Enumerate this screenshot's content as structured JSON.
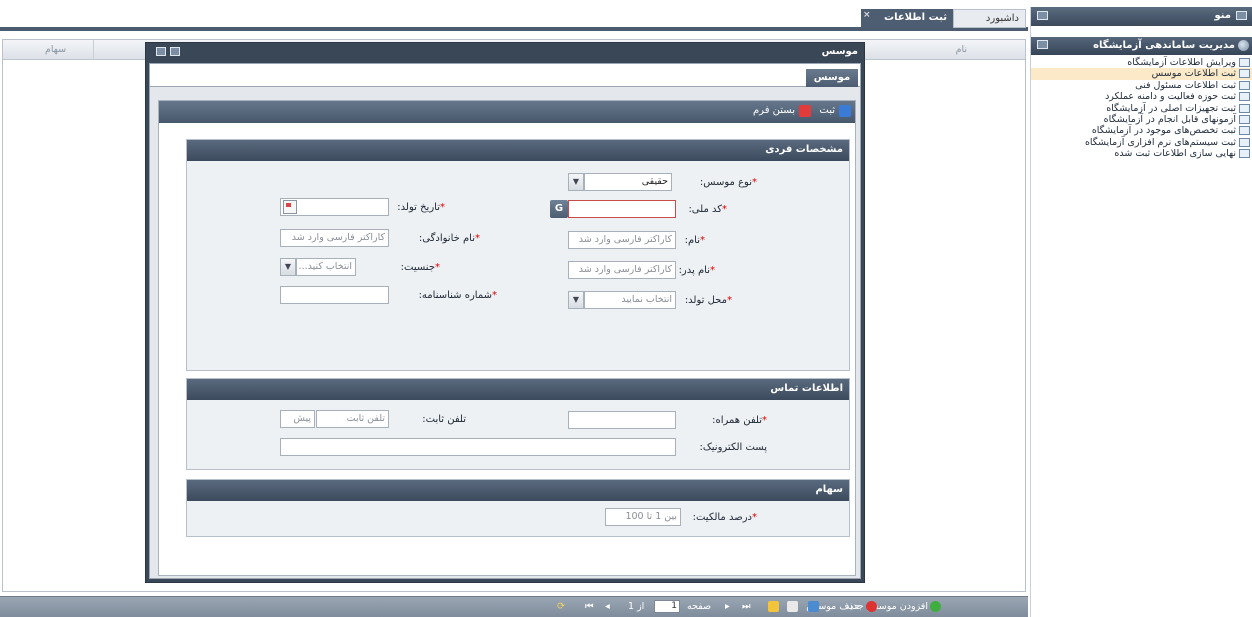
{
  "side_menu": {
    "title": "منو",
    "section_title": "مدیریت ساماندهی آزمایشگاه",
    "items": [
      {
        "label": "ویرایش اطلاعات آزمایشگاه"
      },
      {
        "label": "ثبت اطلاعات موسس"
      },
      {
        "label": "ثبت اطلاعات مسئول فنی"
      },
      {
        "label": "ثبت حوزه فعالیت و دامنه عملکرد"
      },
      {
        "label": "ثبت تجهیزات اصلی در آزمایشگاه"
      },
      {
        "label": "آزمونهای قابل انجام در آزمایشگاه"
      },
      {
        "label": "ثبت تخصص‌های موجود در آزمایشگاه"
      },
      {
        "label": "ثبت سیستم‌های نرم افزاری آزمایشگاه"
      },
      {
        "label": "نهایی سازی اطلاعات ثبت شده"
      }
    ],
    "selected_index": 1
  },
  "tabs": [
    {
      "label": "داشبورد"
    },
    {
      "label": "ثبت اطلاعات موسس",
      "close": "×"
    }
  ],
  "grid": {
    "columns": [
      "نام",
      "سهام"
    ]
  },
  "window": {
    "title": "موسس",
    "inner_tab": "موسس",
    "toolbar": {
      "save_label": "ثبت",
      "close_label": "بستن فرم"
    },
    "sections": {
      "personal": {
        "title": "مشخصات فردی",
        "founder_type_label": "نوع موسس:",
        "founder_type_value": "حقیقی",
        "national_code_label": "کد ملی:",
        "national_code_value": "",
        "national_code_button": "G",
        "birth_date_label": "تاریخ تولد:",
        "birth_date_value": "",
        "first_name_label": "نام:",
        "first_name_placeholder": "کاراکتر فارسی وارد شد",
        "last_name_label": "نام خانوادگی:",
        "last_name_placeholder": "کاراکتر فارسی وارد شد",
        "father_name_label": "نام پدر:",
        "father_name_placeholder": "کاراکتر فارسی وارد شد",
        "gender_label": "جنسیت:",
        "gender_placeholder": "انتخاب کنید...",
        "birth_place_label": "محل تولد:",
        "birth_place_placeholder": "انتخاب نمایید",
        "id_number_label": "شماره شناسنامه:",
        "id_number_value": ""
      },
      "contact": {
        "title": "اطلاعات تماس",
        "mobile_label": "تلفن همراه:",
        "mobile_value": "",
        "phone_label": "تلفن ثابت:",
        "phone_placeholder": "تلفن ثابت",
        "prefix_placeholder": "پیش",
        "email_label": "پست الکترونیک:",
        "email_value": ""
      },
      "shares": {
        "title": "سهام",
        "ownership_label": "درصد مالکیت:",
        "ownership_placeholder": "بین 1 تا 100"
      }
    }
  },
  "pager": {
    "add_label": "افزودن موسس جدید",
    "delete_label": "حذف موسس",
    "page_label": "صفحه",
    "page_value": "1",
    "page_of": "از 1"
  },
  "colors": {
    "header_dark": "#3b495b",
    "selected_menu": "#fbe9c7",
    "required_star": "#dd0000"
  }
}
